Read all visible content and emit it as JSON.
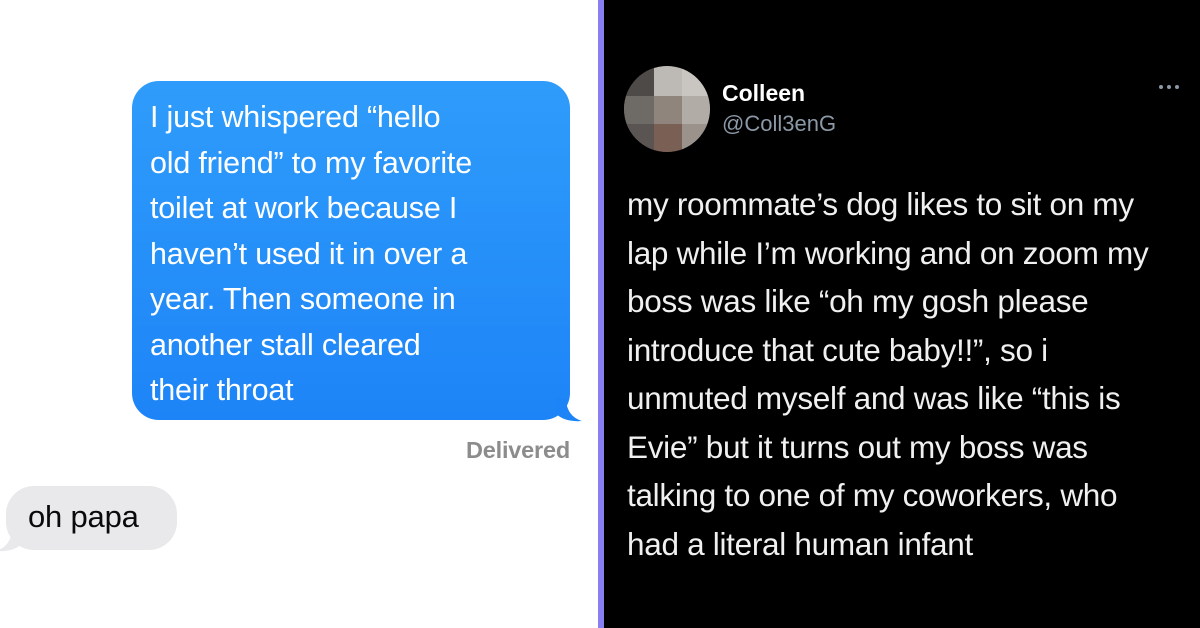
{
  "imessage": {
    "sent_lines": [
      "I just whispered “hello",
      "old friend” to my favorite",
      "toilet at work because I",
      "haven’t used it in over a",
      "year. Then someone in",
      "another stall cleared",
      "their throat"
    ],
    "delivered_label": "Delivered",
    "received_text": "oh papa",
    "colors": {
      "sent_bubble": "#1d84f7",
      "received_bubble": "#e9e9eb",
      "status_text": "#8c8c8c"
    }
  },
  "tweet": {
    "display_name": "Colleen",
    "handle": "@Coll3enG",
    "more_icon": "more-horizontal-icon",
    "avatar_icon": "blurred-avatar",
    "lines": [
      "my roommate’s dog likes to sit on my",
      "lap while I’m working and on zoom my",
      "boss was like “oh my gosh please",
      "introduce that cute baby!!”, so i",
      "unmuted myself and was like “this is",
      "Evie” but it turns out my boss was",
      "talking to one of my coworkers, who",
      "had a literal human infant"
    ],
    "colors": {
      "background": "#000000",
      "handle": "#8b98a5"
    }
  },
  "divider_color": "#8a7ff0"
}
